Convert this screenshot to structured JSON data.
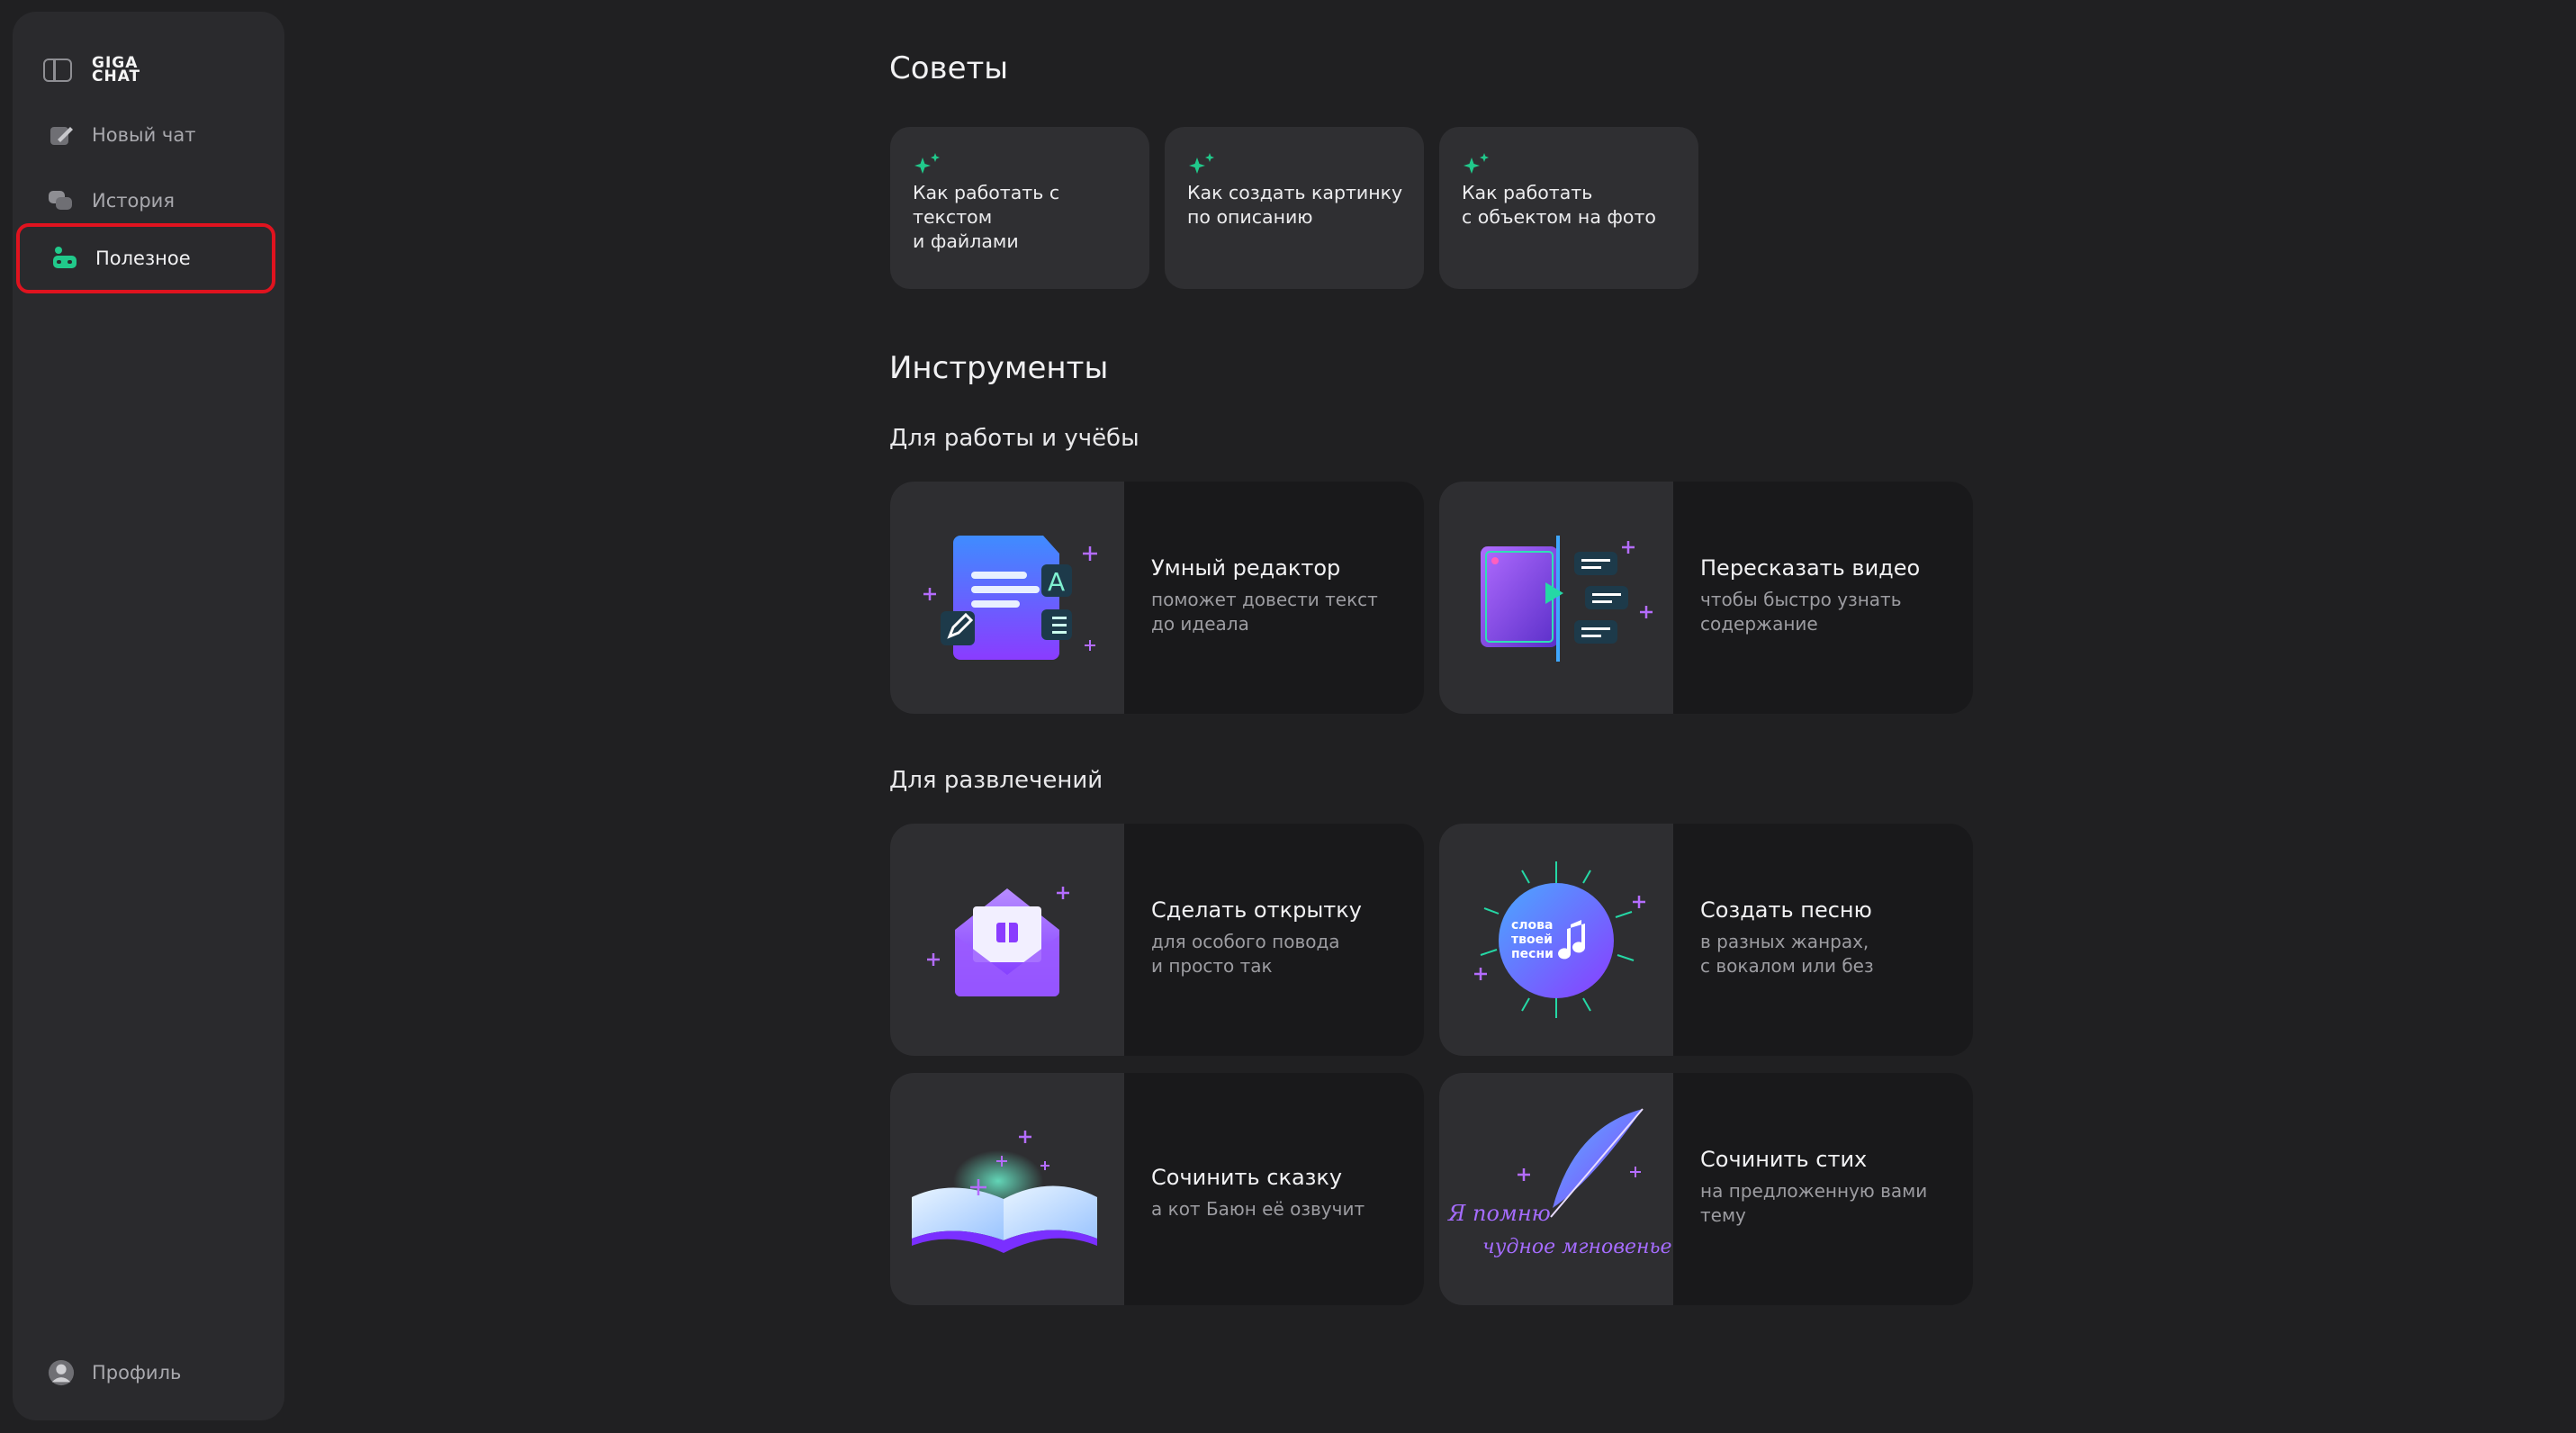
{
  "app": {
    "logo_text_1": "GIGA",
    "logo_text_2": "CHAT"
  },
  "sidebar": {
    "items": [
      {
        "label": "Новый чат",
        "icon": "pencil-icon"
      },
      {
        "label": "История",
        "icon": "chat-bubbles-icon"
      },
      {
        "label": "Полезное",
        "icon": "robot-icon",
        "active": true
      }
    ],
    "profile_label": "Профиль"
  },
  "tips": {
    "heading": "Советы",
    "cards": [
      {
        "line1": "Как работать с текстом",
        "line2": "и файлами"
      },
      {
        "line1": "Как создать картинку",
        "line2": "по описанию"
      },
      {
        "line1": "Как работать",
        "line2": "с объектом на фото"
      }
    ]
  },
  "tools": {
    "heading": "Инструменты",
    "work_heading": "Для работы и учёбы",
    "fun_heading": "Для развлечений",
    "cards": [
      {
        "title": "Умный редактор",
        "sub1": "поможет довести текст",
        "sub2": "до идеала"
      },
      {
        "title": "Пересказать видео",
        "sub1": "чтобы быстро узнать",
        "sub2": "содержание"
      },
      {
        "title": "Сделать открытку",
        "sub1": "для особого повода",
        "sub2": "и просто так"
      },
      {
        "title": "Создать песню",
        "sub1": "в разных жанрах,",
        "sub2": "с вокалом или без",
        "art_text_1": "слова",
        "art_text_2": "твоей",
        "art_text_3": "песни"
      },
      {
        "title": "Сочинить сказку",
        "sub1": "а кот Баюн её озвучит",
        "sub2": ""
      },
      {
        "title": "Сочинить стих",
        "sub1": "на предложенную вами",
        "sub2": "тему",
        "art_text_1": "Я помню",
        "art_text_2": "чудное мгновенье"
      }
    ]
  },
  "colors": {
    "accent_green": "#21c98b",
    "accent_purple": "#8a3cff",
    "highlight_red": "#e0131f",
    "background": "#202022"
  }
}
